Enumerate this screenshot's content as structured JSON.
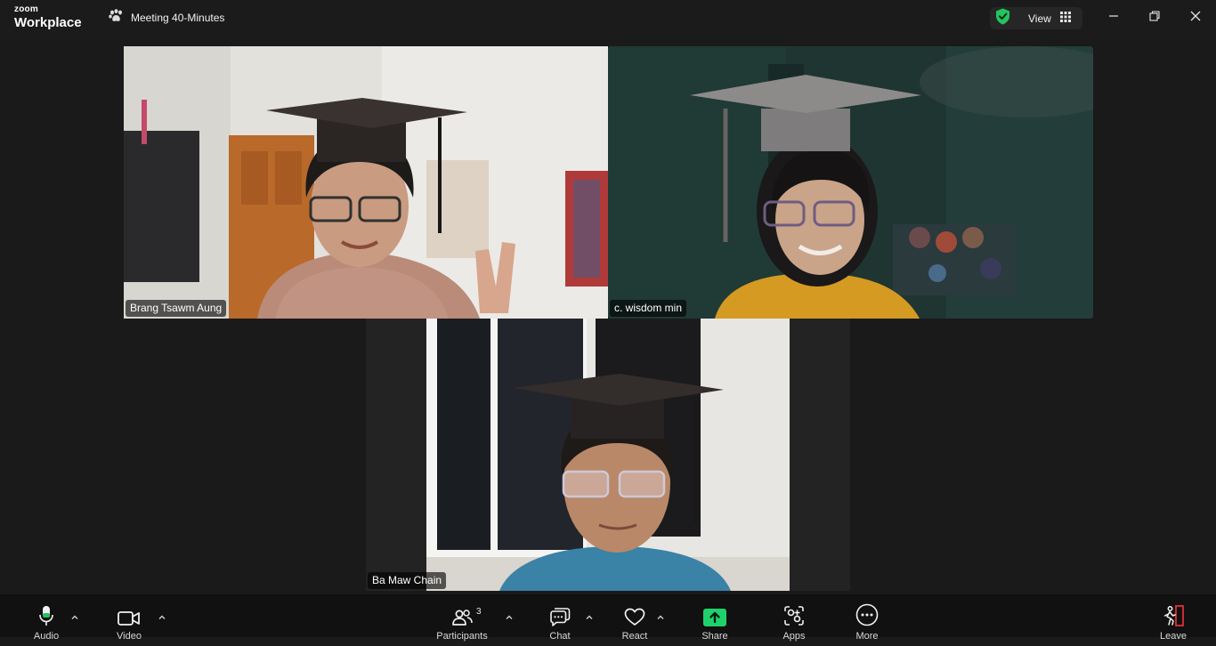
{
  "app": {
    "brand_top": "zoom",
    "brand_main": "Workplace"
  },
  "meeting": {
    "title": "Meeting 40-Minutes"
  },
  "view": {
    "label": "View"
  },
  "colors": {
    "accent_green": "#2fd970",
    "share_green": "#1fd16b",
    "leave_red": "#e0303a"
  },
  "participants": [
    {
      "name": "Brang Tsawm Aung",
      "active": false
    },
    {
      "name": "c. wisdom min",
      "active": true
    },
    {
      "name": "Ba Maw Chain",
      "active": false
    }
  ],
  "toolbar": {
    "audio": "Audio",
    "video": "Video",
    "participants": "Participants",
    "participants_count": "3",
    "chat": "Chat",
    "react": "React",
    "share": "Share",
    "apps": "Apps",
    "more": "More",
    "leave": "Leave"
  },
  "icons": {
    "title": [
      "paw-icon",
      "shield-check-icon",
      "grid-icon",
      "minimize-icon",
      "restore-icon",
      "close-icon"
    ],
    "toolbar": [
      "microphone-icon",
      "camera-icon",
      "participants-icon",
      "chat-icon",
      "heart-icon",
      "share-screen-icon",
      "apps-icon",
      "more-icon",
      "leave-icon"
    ]
  }
}
